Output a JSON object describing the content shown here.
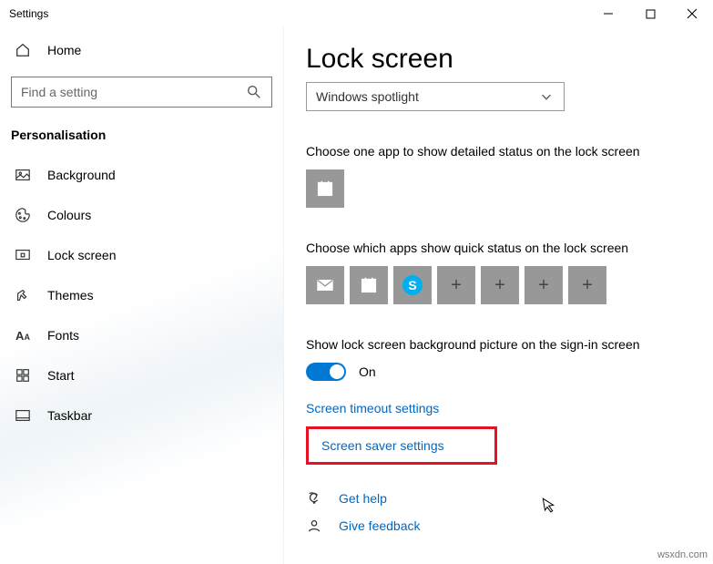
{
  "window": {
    "title": "Settings"
  },
  "sidebar": {
    "home": "Home",
    "search_placeholder": "Find a setting",
    "section": "Personalisation",
    "items": [
      {
        "label": "Background"
      },
      {
        "label": "Colours"
      },
      {
        "label": "Lock screen"
      },
      {
        "label": "Themes"
      },
      {
        "label": "Fonts"
      },
      {
        "label": "Start"
      },
      {
        "label": "Taskbar"
      }
    ]
  },
  "main": {
    "title": "Lock screen",
    "dropdown_value": "Windows spotlight",
    "detailed_label": "Choose one app to show detailed status on the lock screen",
    "quick_label": "Choose which apps show quick status on the lock screen",
    "signin_label": "Show lock screen background picture on the sign-in screen",
    "toggle_state": "On",
    "link_timeout": "Screen timeout settings",
    "link_saver": "Screen saver settings",
    "help": "Get help",
    "feedback": "Give feedback"
  },
  "watermark": "wsxdn.com"
}
